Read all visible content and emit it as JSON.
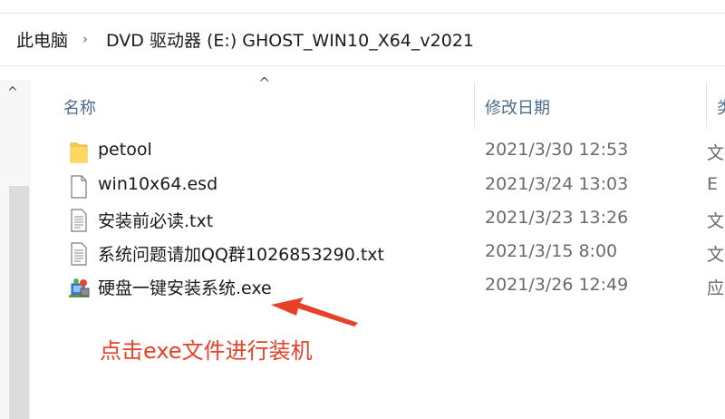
{
  "breadcrumb": {
    "items": [
      "此电脑",
      "DVD 驱动器 (E:) GHOST_WIN10_X64_v2021"
    ],
    "separator": "›"
  },
  "columns": {
    "name": "名称",
    "date": "修改日期",
    "type": "类"
  },
  "files": [
    {
      "name": "petool",
      "date": "2021/3/30 12:53",
      "type": "文",
      "icon": "folder-icon"
    },
    {
      "name": "win10x64.esd",
      "date": "2021/3/24 13:03",
      "type": "E",
      "icon": "file-icon"
    },
    {
      "name": "安装前必读.txt",
      "date": "2021/3/23 13:26",
      "type": "文",
      "icon": "text-file-icon"
    },
    {
      "name": "系统问题请加QQ群1026853290.txt",
      "date": "2021/3/15 8:00",
      "type": "文",
      "icon": "text-file-icon"
    },
    {
      "name": "硬盘一键安装系统.exe",
      "date": "2021/3/26 12:49",
      "type": "应",
      "icon": "installer-exe-icon"
    }
  ],
  "annotation": {
    "text": "点击exe文件进行装机",
    "color": "#e8412a"
  },
  "colors": {
    "folder": "#f6c94a",
    "header_text": "#4d6b8a",
    "date_text": "#6a6a6a"
  }
}
